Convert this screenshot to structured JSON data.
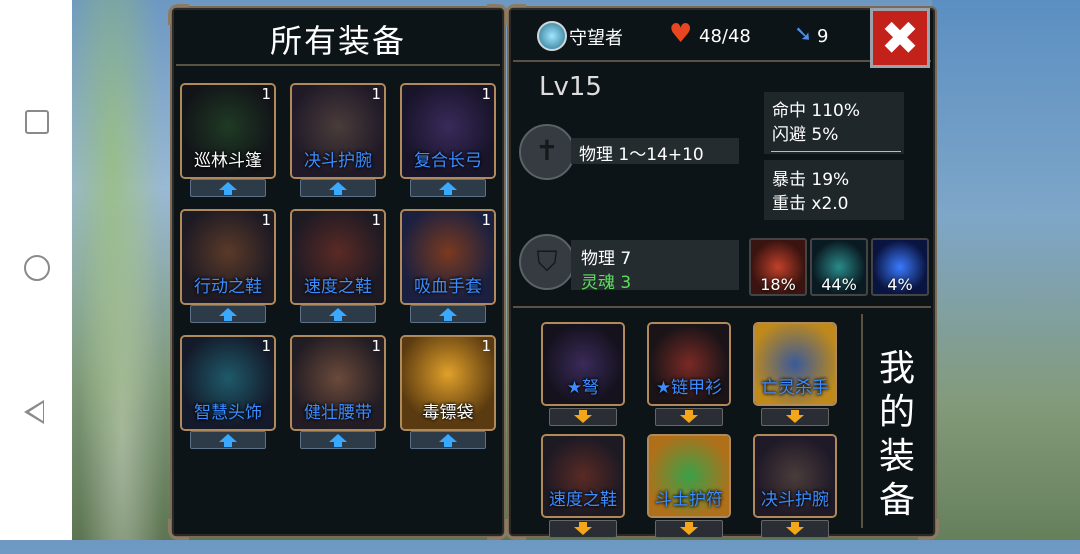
{
  "left_panel": {
    "title": "所有装备",
    "items": [
      {
        "name": "巡林斗篷",
        "count": "1",
        "name_color": "white"
      },
      {
        "name": "决斗护腕",
        "count": "1",
        "name_color": "blue"
      },
      {
        "name": "复合长弓",
        "count": "1",
        "name_color": "blue"
      },
      {
        "name": "行动之鞋",
        "count": "1",
        "name_color": "blue"
      },
      {
        "name": "速度之鞋",
        "count": "1",
        "name_color": "blue"
      },
      {
        "name": "吸血手套",
        "count": "1",
        "name_color": "blue"
      },
      {
        "name": "智慧头饰",
        "count": "1",
        "name_color": "blue"
      },
      {
        "name": "健壮腰带",
        "count": "1",
        "name_color": "blue"
      },
      {
        "name": "毒镖袋",
        "count": "1",
        "name_color": "white"
      }
    ]
  },
  "status": {
    "class_name": "守望者",
    "hp": "48/48",
    "moves": "9",
    "level": "Lv15",
    "attack": "物理  1～14+10",
    "accuracy": "命中  110%",
    "evasion": "闪避  5%",
    "crit": "暴击  19%",
    "heavy_hit": "重击  x2.0",
    "defense_physical": "物理  7",
    "defense_soul": "灵魂  3",
    "resistances": [
      "18%",
      "44%",
      "4%"
    ]
  },
  "my_equipment": {
    "title_chars": [
      "我",
      "的",
      "装",
      "备"
    ],
    "items": [
      {
        "name": "★弩",
        "name_color": "blue"
      },
      {
        "name": "★链甲衫",
        "name_color": "blue"
      },
      {
        "name": "亡灵杀手",
        "name_color": "blue"
      },
      {
        "name": "速度之鞋",
        "name_color": "blue"
      },
      {
        "name": "斗士护符",
        "name_color": "blue"
      },
      {
        "name": "决斗护腕",
        "name_color": "blue"
      }
    ]
  },
  "colors": {
    "accent_blue_arrow": "#39a8ff",
    "accent_orange_arrow": "#f3a61a",
    "close_red": "#c3221a",
    "soul_green": "#5be05b"
  },
  "icons": {
    "close": "close-icon",
    "heart": "heart-icon",
    "boot": "boot-icon",
    "class": "class-emblem-icon"
  }
}
